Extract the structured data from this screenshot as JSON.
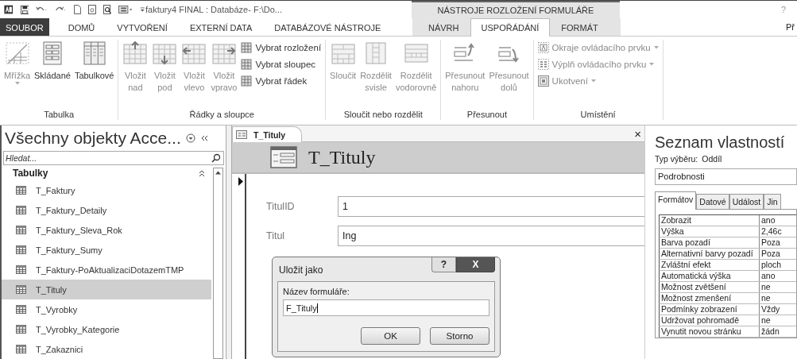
{
  "title_bar": {
    "title": "faktury4 FINAL : Databáze- F:\\Do...",
    "context_title": "NÁSTROJE ROZLOŽENÍ FORMULÁŘE",
    "help": "?"
  },
  "tabs": [
    {
      "label": "SOUBOR",
      "kind": "file",
      "selected": false
    },
    {
      "label": "DOMŮ",
      "kind": "normal",
      "selected": false
    },
    {
      "label": "VYTVOŘENÍ",
      "kind": "normal",
      "selected": false
    },
    {
      "label": "EXTERNÍ DATA",
      "kind": "normal",
      "selected": false
    },
    {
      "label": "DATABÁZOVÉ NÁSTROJE",
      "kind": "normal",
      "selected": false
    },
    {
      "label": "NÁVRH",
      "kind": "context",
      "selected": false
    },
    {
      "label": "USPOŘÁDÁNÍ",
      "kind": "context",
      "selected": true
    },
    {
      "label": "FORMÁT",
      "kind": "context",
      "selected": false
    }
  ],
  "account": "Př",
  "ribbon_groups": [
    {
      "label": "Tabulka",
      "buttons": [
        {
          "label": "Mřížka",
          "kind": "large",
          "disabled": true,
          "dropdown": true
        },
        {
          "label": "Skládané",
          "kind": "large",
          "disabled": false,
          "dropdown": false
        },
        {
          "label": "Tabulkové",
          "kind": "large",
          "disabled": false,
          "dropdown": false
        }
      ]
    },
    {
      "label": "Řádky a sloupce",
      "buttons": [
        {
          "label": "Vložit nad",
          "kind": "large",
          "disabled": true,
          "dropdown": false
        },
        {
          "label": "Vložit pod",
          "kind": "large",
          "disabled": true,
          "dropdown": false
        },
        {
          "label": "Vložit vlevo",
          "kind": "large",
          "disabled": true,
          "dropdown": false
        },
        {
          "label": "Vložit vpravo",
          "kind": "large",
          "disabled": true,
          "dropdown": false
        },
        {
          "label": "Vybrat rozložení",
          "kind": "small",
          "disabled": false,
          "dropdown": false
        },
        {
          "label": "Vybrat sloupec",
          "kind": "small",
          "disabled": false,
          "dropdown": false
        },
        {
          "label": "Vybrat řádek",
          "kind": "small",
          "disabled": false,
          "dropdown": false
        }
      ]
    },
    {
      "label": "Sloučit nebo rozdělit",
      "buttons": [
        {
          "label": "Sloučit",
          "kind": "large",
          "disabled": true,
          "dropdown": false
        },
        {
          "label": "Rozdělit svisle",
          "kind": "large",
          "disabled": true,
          "dropdown": false
        },
        {
          "label": "Rozdělit vodorovně",
          "kind": "large",
          "disabled": true,
          "dropdown": false
        }
      ]
    },
    {
      "label": "Přesunout",
      "buttons": [
        {
          "label": "Přesunout nahoru",
          "kind": "large",
          "disabled": true,
          "dropdown": false
        },
        {
          "label": "Přesunout dolů",
          "kind": "large",
          "disabled": true,
          "dropdown": false
        }
      ]
    },
    {
      "label": "Umístění",
      "buttons": [
        {
          "label": "Okraje ovládacího prvku",
          "kind": "small",
          "disabled": true,
          "dropdown": true
        },
        {
          "label": "Výplň ovládacího prvku",
          "kind": "small",
          "disabled": true,
          "dropdown": true
        },
        {
          "label": "Ukotvení",
          "kind": "small",
          "disabled": true,
          "dropdown": true
        }
      ]
    }
  ],
  "nav_pane": {
    "title": "Všechny objekty Acce...",
    "search": {
      "placeholder": "Hledat..."
    },
    "section": "Tabulky",
    "items": [
      {
        "label": "T_Faktury",
        "selected": false
      },
      {
        "label": "T_Faktury_Detaily",
        "selected": false
      },
      {
        "label": "T_Faktury_Sleva_Rok",
        "selected": false
      },
      {
        "label": "T_Faktury_Sumy",
        "selected": false
      },
      {
        "label": "T_Faktury-PoAktualizaciDotazemTMP",
        "selected": false
      },
      {
        "label": "T_Tituly",
        "selected": true
      },
      {
        "label": "T_Vyrobky",
        "selected": false
      },
      {
        "label": "T_Vyrobky_Kategorie",
        "selected": false
      },
      {
        "label": "T_Zakaznici",
        "selected": false
      }
    ]
  },
  "document": {
    "tab": "T_Tituly",
    "close": "×",
    "header": "T_Tituly",
    "fields": [
      {
        "label": "TitulID",
        "value": "1"
      },
      {
        "label": "Titul",
        "value": "Ing"
      }
    ]
  },
  "dialog": {
    "title": "Uložit jako",
    "help": "?",
    "close": "X",
    "label": "Název formuláře:",
    "value": "F_Tituly",
    "buttons": [
      "OK",
      "Storno"
    ]
  },
  "property_sheet": {
    "title": "Seznam vlastností",
    "selection_label": "Typ výběru:",
    "selection_value": "Oddíl",
    "object": "Podrobnosti",
    "tabs": [
      {
        "label": "Formátov",
        "selected": true
      },
      {
        "label": "Datové",
        "selected": false
      },
      {
        "label": "Událost",
        "selected": false
      },
      {
        "label": "Jin",
        "selected": false
      }
    ],
    "rows": [
      {
        "name": "Zobrazit",
        "value": "ano"
      },
      {
        "name": "Výška",
        "value": "2,46c"
      },
      {
        "name": "Barva pozadí",
        "value": "Poza"
      },
      {
        "name": "Alternativní barvy pozadí",
        "value": "Poza"
      },
      {
        "name": "Zvláštní efekt",
        "value": "ploch"
      },
      {
        "name": "Automatická výška",
        "value": "ano"
      },
      {
        "name": "Možnost zvětšení",
        "value": "ne"
      },
      {
        "name": "Možnost zmenšení",
        "value": "ne"
      },
      {
        "name": "Podmínky zobrazení",
        "value": "Vždy"
      },
      {
        "name": "Udržovat pohromadě",
        "value": "ne"
      },
      {
        "name": "Vynutit novou stránku",
        "value": "žádn"
      }
    ]
  }
}
